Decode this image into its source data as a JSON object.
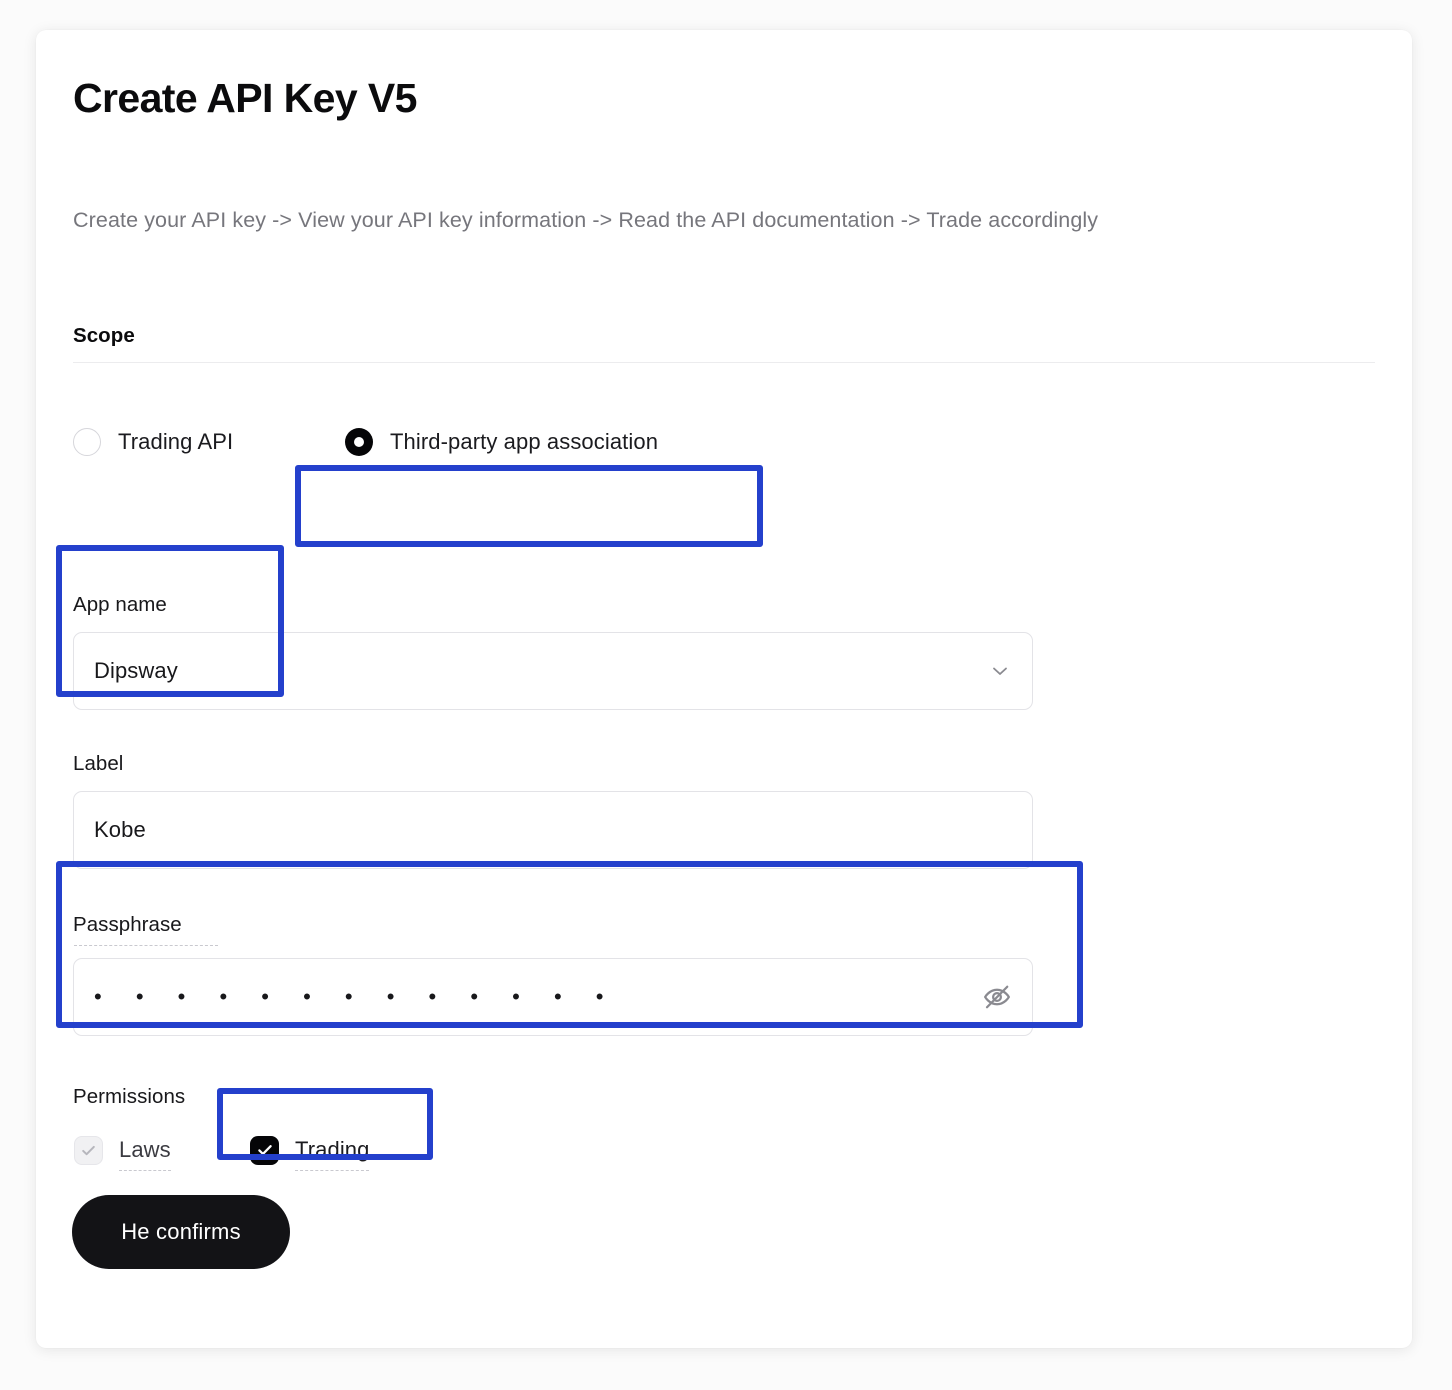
{
  "header": {
    "title": "Create API Key V5",
    "subtitle": "Create your API key -> View your API key information -> Read the API documentation -> Trade accordingly"
  },
  "scope": {
    "label": "Scope",
    "options": [
      {
        "label": "Trading API",
        "selected": false
      },
      {
        "label": "Third-party app association",
        "selected": true
      }
    ]
  },
  "app_name": {
    "label": "App name",
    "value": "Dipsway",
    "chevron_icon": "chevron-down-icon"
  },
  "label_field": {
    "label": "Label",
    "value": "Kobe"
  },
  "passphrase": {
    "label": "Passphrase",
    "masked_value": "• • • • • • • • • • • • •",
    "dot_count": 13,
    "reveal_icon": "eye-off-icon"
  },
  "permissions": {
    "label": "Permissions",
    "options": [
      {
        "label": "Laws",
        "checked": true,
        "disabled": true
      },
      {
        "label": "Trading",
        "checked": true,
        "disabled": false
      }
    ]
  },
  "actions": {
    "confirm_label": "He confirms"
  },
  "colors": {
    "highlight": "#2440CC",
    "accent_black": "#050507",
    "button_bg": "#131316",
    "muted_text": "#76767C",
    "border": "#E3E3E7"
  },
  "annotations": [
    {
      "target": "scope-third-party-option"
    },
    {
      "target": "app-name-group"
    },
    {
      "target": "passphrase-group"
    },
    {
      "target": "permission-trading-option"
    }
  ]
}
